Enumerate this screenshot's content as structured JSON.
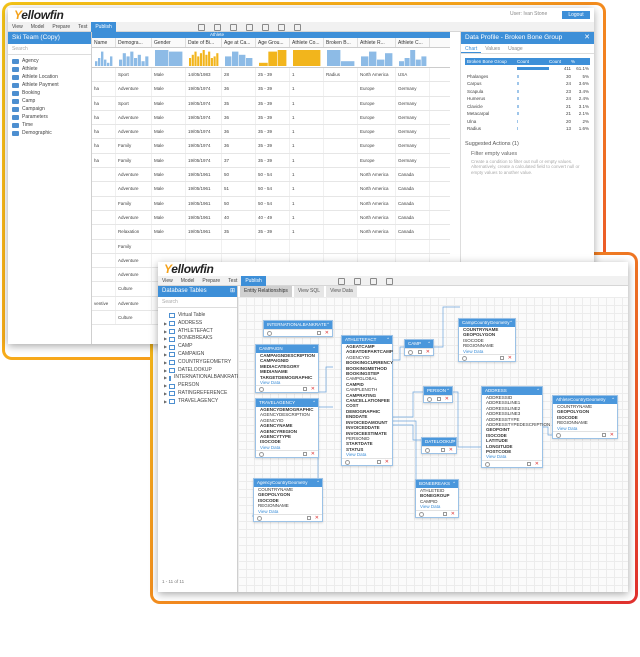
{
  "app": {
    "logo_main": "ellowfin",
    "logo_y": "Y"
  },
  "back": {
    "menu": [
      "View",
      "Model",
      "Prepare",
      "Test",
      "Publish"
    ],
    "active_menu": "Publish",
    "user": "User: Ivan Stone",
    "logout": "Logout",
    "side": {
      "title": "Ski Team (Copy)",
      "search": "Search",
      "folders": [
        "Agency",
        "Athlete",
        "Athlete Location",
        "Athlete Payment",
        "Booking",
        "Camp",
        "Campaign",
        "Parameters",
        "Time",
        "Demographic"
      ]
    },
    "grid": {
      "group_header": "Athlete",
      "columns": [
        "Name",
        "Demogra...",
        "Gender",
        "Date of Bi...",
        "Age at Ca...",
        "Age Grou...",
        "Athlete Co...",
        "Broken B...",
        "Athlete R...",
        "Athlete C..."
      ],
      "rows": [
        [
          "",
          "Sport",
          "Male",
          "14/05/1983",
          "28",
          "25 - 39",
          "1",
          "Radius",
          "North America",
          "USA"
        ],
        [
          "ha",
          "Adventure",
          "Male",
          "19/05/1974",
          "36",
          "35 - 39",
          "1",
          "",
          "Europe",
          "Germany"
        ],
        [
          "ha",
          "Sport",
          "Male",
          "19/05/1974",
          "35",
          "35 - 39",
          "1",
          "",
          "Europe",
          "Germany"
        ],
        [
          "ha",
          "Adventure",
          "Male",
          "19/05/1974",
          "36",
          "35 - 39",
          "1",
          "",
          "Europe",
          "Germany"
        ],
        [
          "ha",
          "Adventure",
          "Male",
          "19/05/1974",
          "36",
          "35 - 39",
          "1",
          "",
          "Europe",
          "Germany"
        ],
        [
          "ha",
          "Family",
          "Male",
          "19/05/1974",
          "36",
          "35 - 39",
          "1",
          "",
          "Europe",
          "Germany"
        ],
        [
          "ha",
          "Family",
          "Male",
          "19/05/1974",
          "37",
          "35 - 39",
          "1",
          "",
          "Europe",
          "Germany"
        ],
        [
          "",
          "Adventure",
          "Male",
          "19/05/1961",
          "50",
          "50 - 54",
          "1",
          "",
          "North America",
          "Canada"
        ],
        [
          "",
          "Adventure",
          "Male",
          "19/05/1961",
          "51",
          "50 - 54",
          "1",
          "",
          "North America",
          "Canada"
        ],
        [
          "",
          "Family",
          "Male",
          "19/05/1961",
          "50",
          "50 - 54",
          "1",
          "",
          "North America",
          "Canada"
        ],
        [
          "",
          "Adventure",
          "Male",
          "19/05/1961",
          "40",
          "40 - 49",
          "1",
          "",
          "North America",
          "Canada"
        ],
        [
          "",
          "Relaxation",
          "Male",
          "19/05/1961",
          "35",
          "35 - 39",
          "1",
          "",
          "North America",
          "Canada"
        ],
        [
          "",
          "Family",
          "",
          "",
          "",
          "",
          "",
          "",
          "",
          ""
        ],
        [
          "",
          "Adventure",
          "",
          "",
          "",
          "",
          "",
          "",
          "",
          ""
        ],
        [
          "",
          "Adventure",
          "",
          "",
          "",
          "",
          "",
          "",
          "",
          ""
        ],
        [
          "",
          "Culture",
          "",
          "",
          "",
          "",
          "",
          "",
          "",
          ""
        ],
        [
          "ventive",
          "Adventure",
          "",
          "Ventive",
          "",
          "",
          "",
          "",
          "",
          ""
        ],
        [
          "",
          "Culture",
          "",
          "",
          "",
          "",
          "",
          "",
          "",
          ""
        ]
      ]
    },
    "profile": {
      "title": "Data Profile - Broken Bone Group",
      "tabs": [
        "Chart",
        "Values",
        "Usage"
      ],
      "head": [
        "Broken Bone Group",
        "Count",
        "Count",
        "%"
      ],
      "rows": [
        {
          "name": "",
          "count": "411",
          "pct": "61.1%",
          "frac": 1.0
        },
        {
          "name": "Phalanges",
          "count": "30",
          "pct": "5%",
          "frac": 0.07
        },
        {
          "name": "Carpus",
          "count": "24",
          "pct": "3.6%",
          "frac": 0.06
        },
        {
          "name": "Scapula",
          "count": "23",
          "pct": "3.4%",
          "frac": 0.055
        },
        {
          "name": "Humerus",
          "count": "24",
          "pct": "2.4%",
          "frac": 0.05
        },
        {
          "name": "Clavicle",
          "count": "21",
          "pct": "3.1%",
          "frac": 0.05
        },
        {
          "name": "Metacarpal",
          "count": "21",
          "pct": "2.1%",
          "frac": 0.05
        },
        {
          "name": "Ulna",
          "count": "20",
          "pct": "2%",
          "frac": 0.045
        },
        {
          "name": "Radius",
          "count": "13",
          "pct": "1.6%",
          "frac": 0.03
        }
      ],
      "suggested_title": "Suggested Actions (1)",
      "suggested_action": "Filter empty values",
      "suggested_desc": "Create a condition to filter out null or empty values. Alternatively, create a calculated field to convert null or empty values to another value."
    },
    "histograms": [
      [
        0.3,
        0.5,
        0.9,
        0.4,
        0.2,
        0.6
      ],
      [
        0.4,
        0.8,
        0.6,
        0.9,
        0.5,
        0.7,
        0.3,
        0.6
      ],
      [
        1.0,
        0.9
      ],
      [
        0.5,
        0.7,
        0.9,
        0.6,
        0.8,
        1.0,
        0.7,
        0.9,
        0.5,
        0.6,
        0.8
      ],
      [
        0.6,
        0.9,
        0.7,
        0.5
      ],
      [
        0.2,
        0.9,
        1.0
      ],
      [
        1.0
      ],
      [
        1.0,
        0.3
      ],
      [
        0.6,
        0.9,
        0.4,
        0.8
      ],
      [
        0.3,
        0.5,
        1.0,
        0.4,
        0.6
      ]
    ]
  },
  "front": {
    "menu": [
      "View",
      "Model",
      "Prepare",
      "Test",
      "Publish"
    ],
    "active_menu": "Publish",
    "side": {
      "title": "Database Tables",
      "search": "Search",
      "tables": [
        "Virtual Table",
        "ADDRESS",
        "ATHLETEFACT",
        "BONEBREAKS",
        "CAMP",
        "CAMPAIGN",
        "COUNTRYGEOMETRY",
        "DATELOOKUP",
        "INTERNATIONALBANKRATE",
        "PERSON",
        "RATINGREFERENCE",
        "TRAVELAGENCY"
      ],
      "pager": "1 - 11   of 11"
    },
    "tabs": [
      "Entity Relationships",
      "View SQL",
      "View Data"
    ],
    "entities": [
      {
        "title": "INTERNATIONALBANKRATE",
        "fields": []
      },
      {
        "title": "CAMPAIGN",
        "fields": [
          [
            "CAMPAIGNDESCRIPTION",
            "b"
          ],
          [
            "CAMPAIGNID",
            "b"
          ],
          [
            "MEDIACATEGORY",
            "b"
          ],
          [
            "MEDIANAME",
            "b"
          ],
          [
            "TARGETDEMOGRAPHIC",
            "b"
          ],
          [
            "View Data",
            "l"
          ]
        ]
      },
      {
        "title": "TRAVELAGENCY",
        "fields": [
          [
            "AGENCYDEMOGRAPHIC",
            "b"
          ],
          [
            "AGENCYDESCRIPTION",
            ""
          ],
          [
            "AGENCYID",
            ""
          ],
          [
            "AGENCYNAME",
            "b"
          ],
          [
            "AGENCYREGION",
            "b"
          ],
          [
            "AGENCYTYPE",
            "b"
          ],
          [
            "ISOCODE",
            "b"
          ],
          [
            "View Data",
            "l"
          ]
        ]
      },
      {
        "title": "AgencyCountryGeometry",
        "fields": [
          [
            "COUNTRYNAME",
            ""
          ],
          [
            "GEOPOLYGON",
            "b"
          ],
          [
            "ISOCODE",
            "b"
          ],
          [
            "REGIONNAME",
            ""
          ],
          [
            "View Data",
            "l"
          ]
        ]
      },
      {
        "title": "ATHLETEFACT",
        "fields": [
          [
            "AGEATCAMP",
            "b"
          ],
          [
            "AGEATDEPARTCAMP",
            "b"
          ],
          [
            "AGENCYID",
            ""
          ],
          [
            "BOOKINGCURRENCY",
            "b"
          ],
          [
            "BOOKINGMETHOD",
            "b"
          ],
          [
            "BOOKINGSTEP",
            "b"
          ],
          [
            "CAMPGLOBAL",
            ""
          ],
          [
            "CAMPID",
            "b"
          ],
          [
            "CAMPLENGTH",
            ""
          ],
          [
            "CAMPRATING",
            "b"
          ],
          [
            "CANCELLATIONFEE",
            "b"
          ],
          [
            "COST",
            "b"
          ],
          [
            "DEMOGRAPHIC",
            "b"
          ],
          [
            "ENDDATE",
            "b"
          ],
          [
            "INVOICEDAMOUNT",
            "b"
          ],
          [
            "INVOICEDDATE",
            "b"
          ],
          [
            "INVOICEESTIMATE",
            "b"
          ],
          [
            "PERSONID",
            ""
          ],
          [
            "STARTDATE",
            "b"
          ],
          [
            "STATUS",
            "b"
          ],
          [
            "View Data",
            "l"
          ]
        ]
      },
      {
        "title": "CAMP",
        "fields": []
      },
      {
        "title": "PERSON",
        "fields": []
      },
      {
        "title": "DATELOOKUP",
        "fields": []
      },
      {
        "title": "BONEBREAKS",
        "fields": [
          [
            "ATHLETEID",
            ""
          ],
          [
            "BONEGROUP",
            "b"
          ],
          [
            "CAMPID",
            ""
          ],
          [
            "View Data",
            "l"
          ]
        ]
      },
      {
        "title": "CampCountryGeometry",
        "fields": [
          [
            "COUNTRYNAME",
            "b"
          ],
          [
            "GEOPOLYGON",
            "b"
          ],
          [
            "ISOCODE",
            ""
          ],
          [
            "REGIONNAME",
            ""
          ],
          [
            "View Data",
            "l"
          ]
        ]
      },
      {
        "title": "ADDRESS",
        "fields": [
          [
            "ADDRESSID",
            ""
          ],
          [
            "ADDRESSLINE1",
            ""
          ],
          [
            "ADDRESSLINE2",
            ""
          ],
          [
            "ADDRESSLINE3",
            ""
          ],
          [
            "ADDRESSTYPE",
            ""
          ],
          [
            "ADDRESSTYPEDESCRIPTION",
            ""
          ],
          [
            "GEOPOINT",
            "b"
          ],
          [
            "ISOCODE",
            "b"
          ],
          [
            "LATITUDE",
            "b"
          ],
          [
            "LONGITUDE",
            "b"
          ],
          [
            "POSTCODE",
            "b"
          ],
          [
            "View Data",
            "l"
          ]
        ]
      },
      {
        "title": "AthleteCountryGeometry",
        "fields": [
          [
            "COUNTRYNAME",
            ""
          ],
          [
            "GEOPOLYGON",
            "b"
          ],
          [
            "ISOCODE",
            "b"
          ],
          [
            "REGIONNAME",
            ""
          ],
          [
            "View Data",
            "l"
          ]
        ]
      }
    ]
  }
}
